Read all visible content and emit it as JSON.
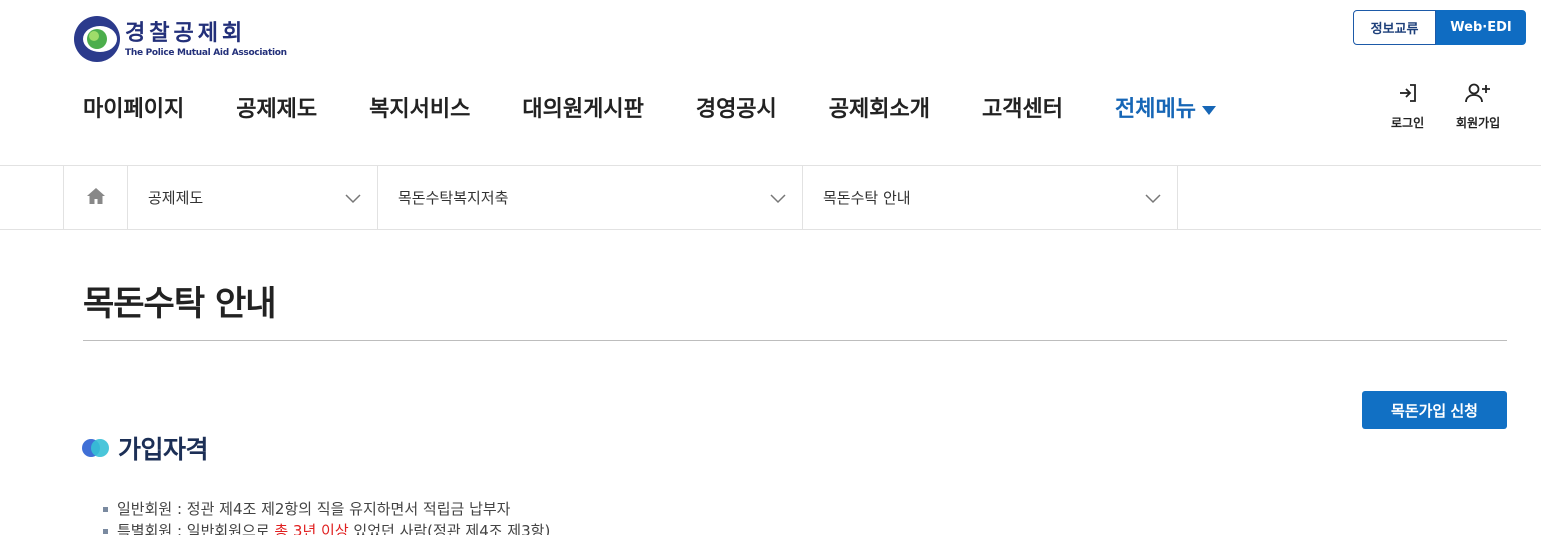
{
  "header": {
    "logo_kr": "경찰공제회",
    "logo_en": "The Police Mutual Aid Association",
    "top_links": {
      "info": "정보교류",
      "edi": "Web·EDI"
    },
    "gnb": [
      "마이페이지",
      "공제제도",
      "복지서비스",
      "대의원게시판",
      "경영공시",
      "공제회소개",
      "고객센터"
    ],
    "all_menu": "전체메뉴",
    "login": "로그인",
    "join": "회원가입"
  },
  "location": {
    "seg1": "공제제도",
    "seg2": "목돈수탁복지저축",
    "seg3": "목돈수탁 안내"
  },
  "page": {
    "title": "목돈수탁 안내",
    "apply_button": "목돈가입 신청",
    "section_title": "가입자격",
    "bullet1": "일반회원 : 정관 제4조 제2항의 직을 유지하면서 적립금 납부자",
    "bullet2_pre": "특별회원 : 일반회원으로 ",
    "bullet2_red": "총 3년 이상",
    "bullet2_post": " 있었던 사람(정관 제4조 제3항)"
  },
  "colors": {
    "brand_blue": "#1170c4",
    "nav_accent": "#1666b6",
    "logo_navy": "#23307a",
    "highlight": "#e02020"
  }
}
